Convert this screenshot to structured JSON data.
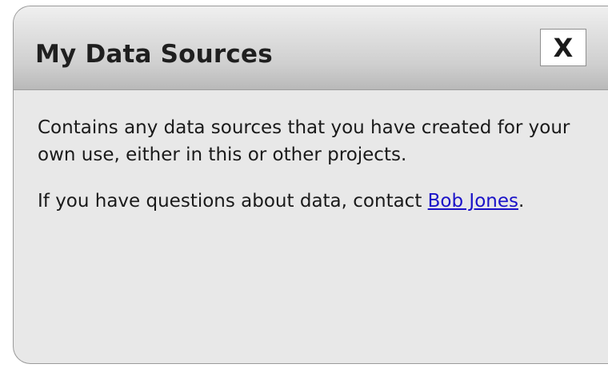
{
  "dialog": {
    "title": "My Data Sources",
    "close_label": "X",
    "description": "Contains any data sources that you have created for your own use, either in this or other projects.",
    "contact_prefix": "If you have questions about data, contact ",
    "contact_link_text": "Bob Jones",
    "contact_suffix": "."
  },
  "colors": {
    "link": "#1a12c8",
    "panel_background": "#e8e8e8",
    "header_gradient_top": "#f0f0f0",
    "header_gradient_bottom": "#b9b9b9"
  },
  "icons": {
    "close": "close-icon"
  }
}
